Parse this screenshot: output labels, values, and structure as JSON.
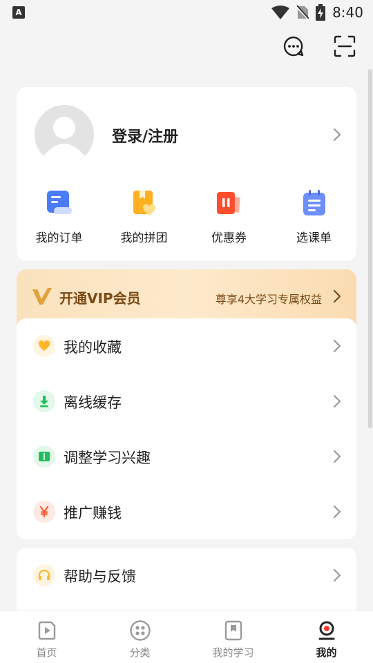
{
  "status_bar": {
    "time": "8:40",
    "keyboard_indicator": "A"
  },
  "profile": {
    "login_label": "登录/注册"
  },
  "quick_actions": [
    {
      "label": "我的订单",
      "icon": "order-icon"
    },
    {
      "label": "我的拼团",
      "icon": "group-buy-icon"
    },
    {
      "label": "优惠券",
      "icon": "coupon-icon"
    },
    {
      "label": "选课单",
      "icon": "course-list-icon"
    }
  ],
  "vip": {
    "title": "开通VIP会员",
    "description": "尊享4大学习专属权益"
  },
  "menu": [
    {
      "label": "我的收藏",
      "icon": "heart-icon"
    },
    {
      "label": "离线缓存",
      "icon": "download-icon"
    },
    {
      "label": "调整学习兴趣",
      "icon": "interest-book-icon"
    },
    {
      "label": "推广赚钱",
      "icon": "yen-icon"
    }
  ],
  "menu2": [
    {
      "label": "帮助与反馈",
      "icon": "headset-icon"
    }
  ],
  "tabs": [
    {
      "label": "首页",
      "icon": "home-play-icon"
    },
    {
      "label": "分类",
      "icon": "category-icon"
    },
    {
      "label": "我的学习",
      "icon": "bookmark-icon"
    },
    {
      "label": "我的",
      "icon": "profile-icon"
    }
  ],
  "colors": {
    "accent": "#ff3b30",
    "vip_text": "#7a4a15",
    "tab_inactive": "#8a8a8a"
  }
}
